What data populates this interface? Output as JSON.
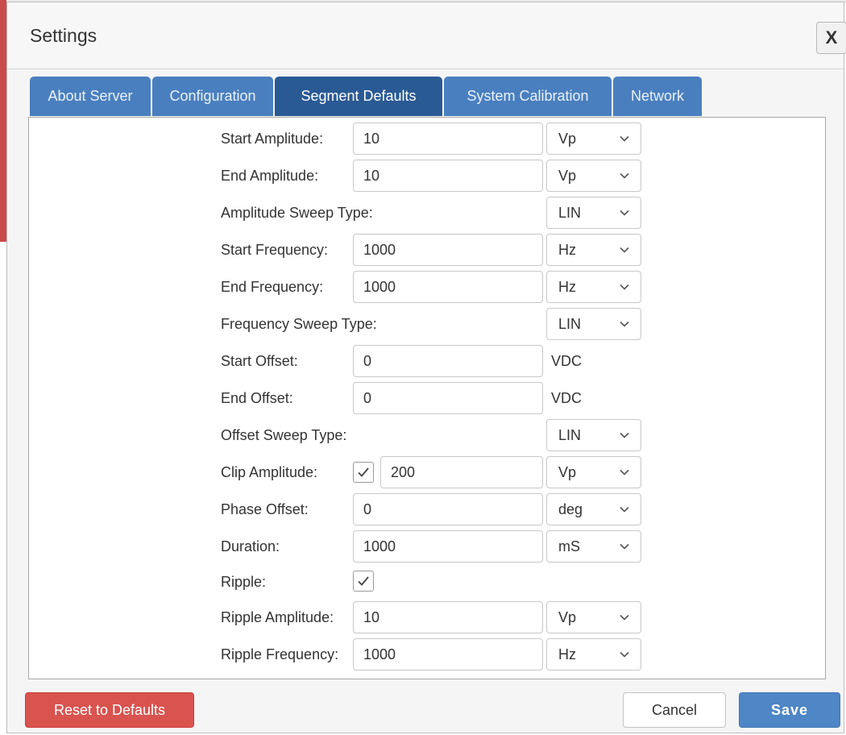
{
  "dialog": {
    "title": "Settings",
    "close_label": "X"
  },
  "tabs": [
    {
      "label": "About Server",
      "active": false
    },
    {
      "label": "Configuration",
      "active": false
    },
    {
      "label": "Segment Defaults",
      "active": true
    },
    {
      "label": "System Calibration",
      "active": false
    },
    {
      "label": "Network",
      "active": false
    }
  ],
  "form": {
    "start_amplitude": {
      "label": "Start Amplitude:",
      "value": "10",
      "unit": "Vp"
    },
    "end_amplitude": {
      "label": "End Amplitude:",
      "value": "10",
      "unit": "Vp"
    },
    "amplitude_sweep_type": {
      "label": "Amplitude Sweep Type:",
      "unit": "LIN"
    },
    "start_frequency": {
      "label": "Start Frequency:",
      "value": "1000",
      "unit": "Hz"
    },
    "end_frequency": {
      "label": "End Frequency:",
      "value": "1000",
      "unit": "Hz"
    },
    "frequency_sweep_type": {
      "label": "Frequency Sweep Type:",
      "unit": "LIN"
    },
    "start_offset": {
      "label": "Start Offset:",
      "value": "0",
      "unit": "VDC"
    },
    "end_offset": {
      "label": "End Offset:",
      "value": "0",
      "unit": "VDC"
    },
    "offset_sweep_type": {
      "label": "Offset Sweep Type:",
      "unit": "LIN"
    },
    "clip_amplitude": {
      "label": "Clip Amplitude:",
      "checked": true,
      "value": "200",
      "unit": "Vp"
    },
    "phase_offset": {
      "label": "Phase Offset:",
      "value": "0",
      "unit": "deg"
    },
    "duration": {
      "label": "Duration:",
      "value": "1000",
      "unit": "mS"
    },
    "ripple": {
      "label": "Ripple:",
      "checked": true
    },
    "ripple_amplitude": {
      "label": "Ripple Amplitude:",
      "value": "10",
      "unit": "Vp"
    },
    "ripple_frequency": {
      "label": "Ripple Frequency:",
      "value": "1000",
      "unit": "Hz"
    }
  },
  "footer": {
    "reset_label": "Reset to Defaults",
    "cancel_label": "Cancel",
    "save_label": "Save"
  },
  "colors": {
    "tab": "#4a7fbf",
    "tab_active": "#2a5a94",
    "reset": "#d9534f",
    "save": "#4e86c6"
  },
  "icons": {
    "select_arrow": "chevron-down-icon",
    "check": "check-icon"
  }
}
